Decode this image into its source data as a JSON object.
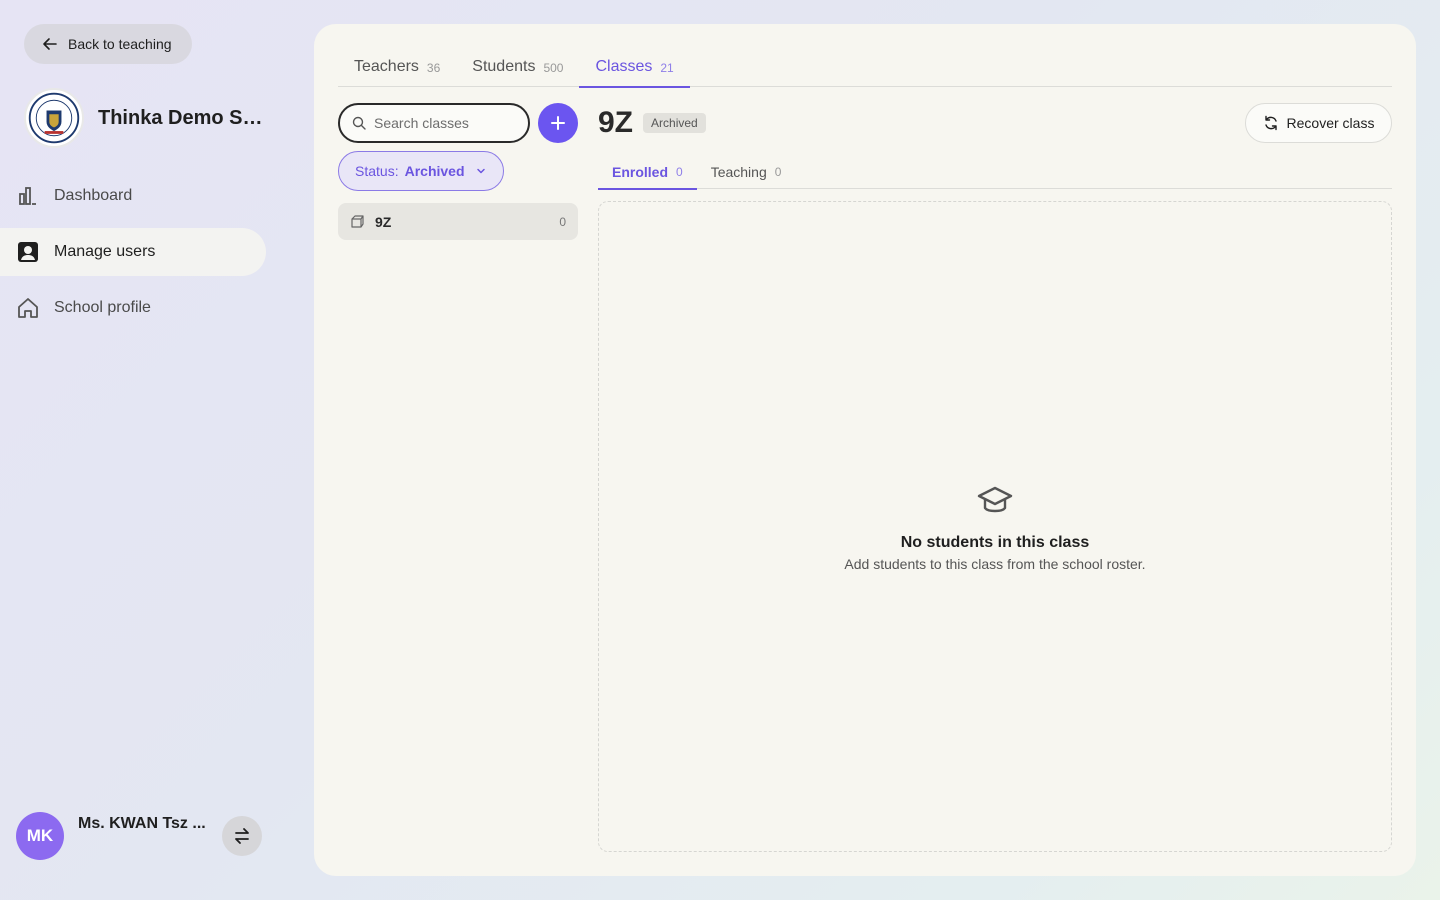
{
  "sidebar": {
    "back_label": "Back to teaching",
    "school_name": "Thinka Demo Se...",
    "nav": [
      {
        "label": "Dashboard",
        "icon": "bar-chart-icon"
      },
      {
        "label": "Manage users",
        "icon": "user-badge-icon"
      },
      {
        "label": "School profile",
        "icon": "home-icon"
      }
    ],
    "user": {
      "initials": "MK",
      "name": "Ms. KWAN Tsz ...",
      "avatar_color": "#8c6af0"
    }
  },
  "main": {
    "tabs": [
      {
        "label": "Teachers",
        "count": "36"
      },
      {
        "label": "Students",
        "count": "500"
      },
      {
        "label": "Classes",
        "count": "21"
      }
    ],
    "search_placeholder": "Search classes",
    "filter": {
      "label": "Status:",
      "value": "Archived"
    },
    "classes": [
      {
        "name": "9Z",
        "count": "0"
      }
    ],
    "detail": {
      "title": "9Z",
      "badge": "Archived",
      "recover_label": "Recover class",
      "subtabs": [
        {
          "label": "Enrolled",
          "count": "0"
        },
        {
          "label": "Teaching",
          "count": "0"
        }
      ],
      "empty_title": "No students in this class",
      "empty_subtitle": "Add students to this class from the school roster."
    },
    "accent_color": "#6b55e0"
  }
}
